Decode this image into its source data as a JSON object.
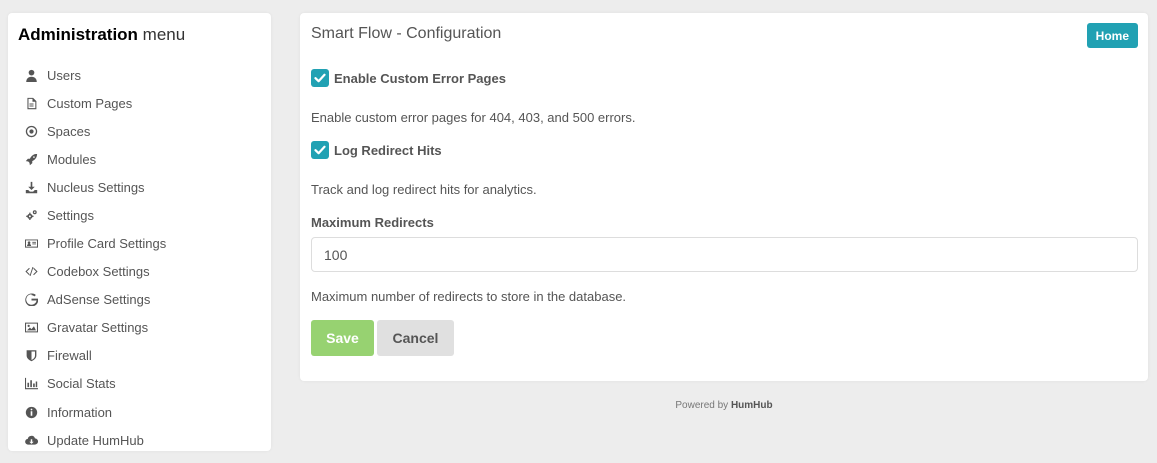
{
  "sidebar": {
    "title_bold": "Administration",
    "title_rest": " menu",
    "items": [
      {
        "label": "Users",
        "icon": "user-icon"
      },
      {
        "label": "Custom Pages",
        "icon": "file-icon"
      },
      {
        "label": "Spaces",
        "icon": "dot-circle-icon"
      },
      {
        "label": "Modules",
        "icon": "rocket-icon"
      },
      {
        "label": "Nucleus Settings",
        "icon": "download-icon"
      },
      {
        "label": "Settings",
        "icon": "cogs-icon"
      },
      {
        "label": "Profile Card Settings",
        "icon": "id-card-icon"
      },
      {
        "label": "Codebox Settings",
        "icon": "code-icon"
      },
      {
        "label": "AdSense Settings",
        "icon": "google-icon"
      },
      {
        "label": "Gravatar Settings",
        "icon": "image-icon"
      },
      {
        "label": "Firewall",
        "icon": "shield-icon"
      },
      {
        "label": "Social Stats",
        "icon": "bar-chart-icon"
      },
      {
        "label": "Information",
        "icon": "info-circle-icon"
      },
      {
        "label": "Update HumHub",
        "icon": "cloud-download-icon"
      }
    ]
  },
  "panel": {
    "title": "Smart Flow - Configuration",
    "home_label": "Home",
    "enable_custom_errors": {
      "label": "Enable Custom Error Pages",
      "checked": true,
      "help": "Enable custom error pages for 404, 403, and 500 errors."
    },
    "log_redirect": {
      "label": "Log Redirect Hits",
      "checked": true,
      "help": "Track and log redirect hits for analytics."
    },
    "max_redirects": {
      "label": "Maximum Redirects",
      "value": "100",
      "help": "Maximum number of redirects to store in the database."
    },
    "save_label": "Save",
    "cancel_label": "Cancel"
  },
  "footer": {
    "prefix": "Powered by ",
    "brand": "HumHub"
  },
  "colors": {
    "accent": "#21a1b3",
    "save": "#97d271",
    "background": "#ededed"
  }
}
